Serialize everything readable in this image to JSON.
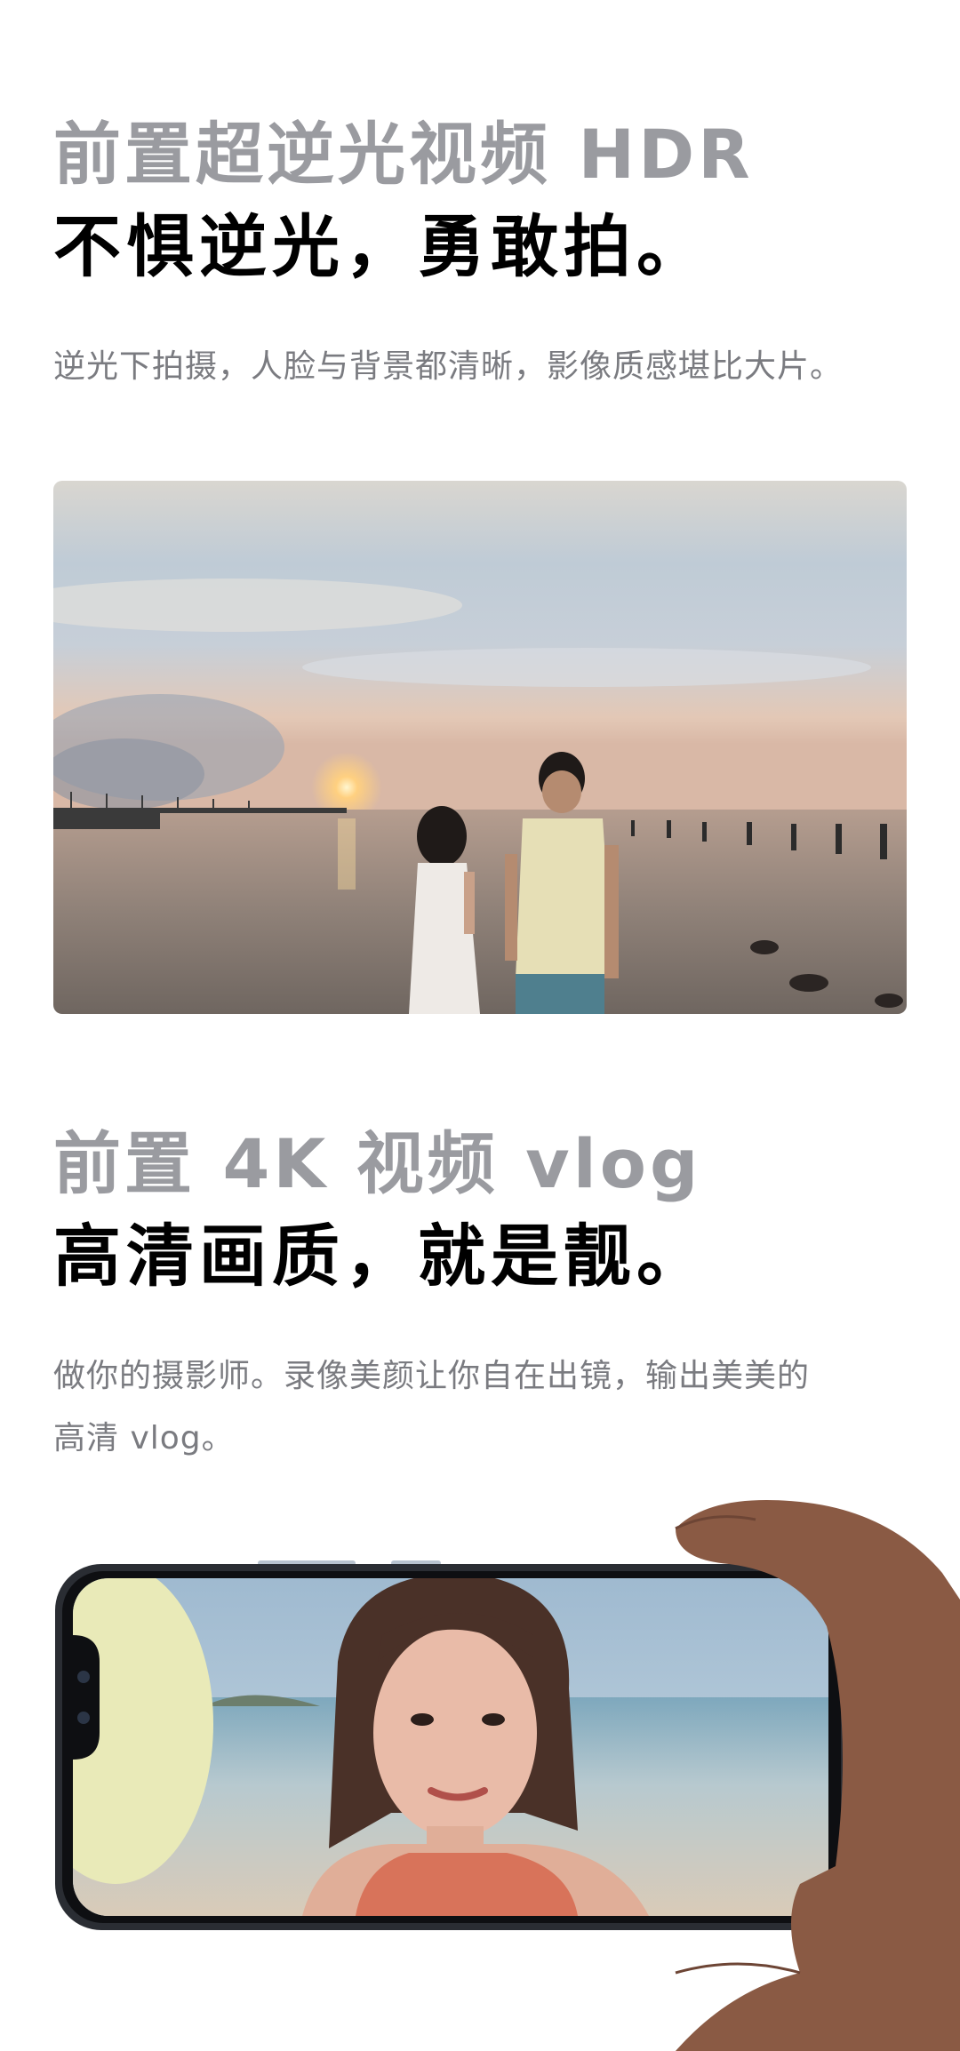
{
  "section1": {
    "title_grey": "前置超逆光视频 HDR",
    "title_black": "不惧逆光，勇敢拍。",
    "description": "逆光下拍摄，人脸与背景都清晰，影像质感堪比大片。"
  },
  "section2": {
    "title_grey": "前置 4K 视频 vlog",
    "title_black": "高清画质，就是靓。",
    "description_line1": "做你的摄影师。录像美颜让你自在出镜，输出美美的",
    "description_line2": "高清 vlog。"
  },
  "colors": {
    "grey_title": "#9a9ba0",
    "black_title": "#000000",
    "body_text": "#7a7b80",
    "background": "#ffffff"
  }
}
